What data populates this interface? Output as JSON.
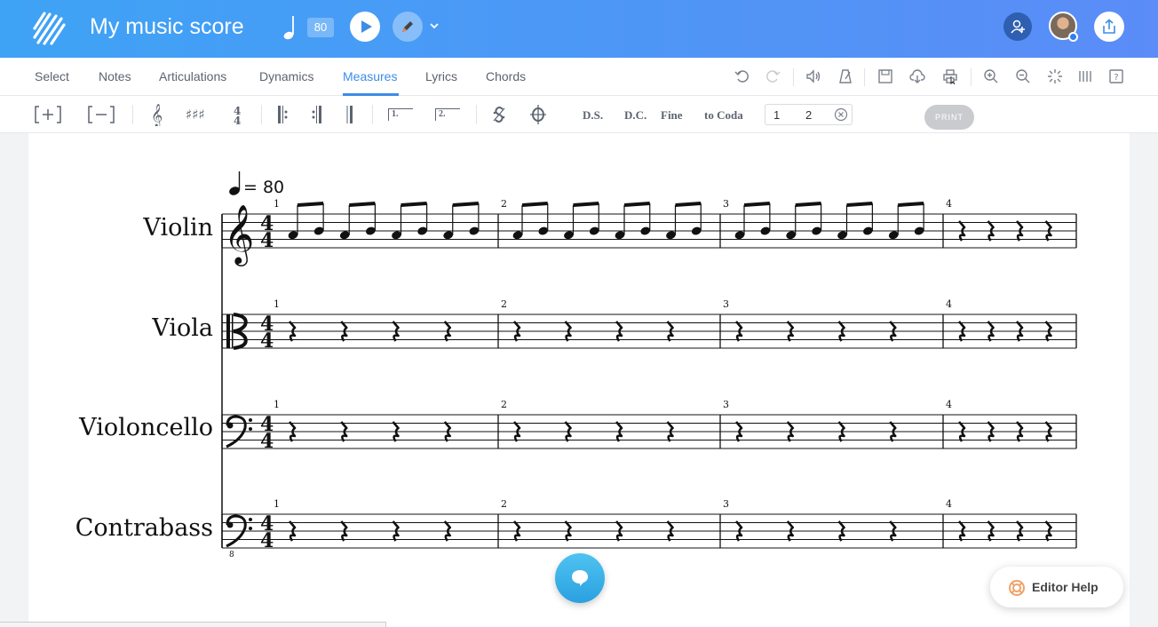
{
  "app": {
    "title": "My music score",
    "tempo": "80",
    "colors": {
      "header_start": "#3ea3f5",
      "header_end": "#5b8cf7",
      "accent": "#3d8de6"
    }
  },
  "tabs": [
    {
      "label": "Select"
    },
    {
      "label": "Notes"
    },
    {
      "label": "Articulations"
    },
    {
      "label": "Dynamics"
    },
    {
      "label": "Measures",
      "active": true
    },
    {
      "label": "Lyrics"
    },
    {
      "label": "Chords"
    }
  ],
  "measure_toolbar": {
    "ds": "D.S.",
    "dc": "D.C.",
    "fine": "Fine",
    "to_coda": "to Coda",
    "ending_first": "1",
    "ending_second": "2",
    "ending1_label": "1.",
    "ending2_label": "2."
  },
  "tooltip": {
    "print": "PRINT"
  },
  "score": {
    "tempo_marking": "= 80",
    "measure_numbers": [
      "1",
      "2",
      "3",
      "4"
    ],
    "instruments": [
      {
        "name": "Violin",
        "clef": "treble"
      },
      {
        "name": "Viola",
        "clef": "alto"
      },
      {
        "name": "Violoncello",
        "clef": "bass"
      },
      {
        "name": "Contrabass",
        "clef": "bass-8vb"
      }
    ],
    "time_signature": "4/4"
  },
  "help": {
    "label": "Editor Help"
  }
}
